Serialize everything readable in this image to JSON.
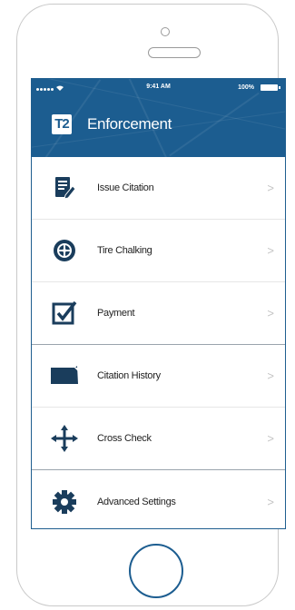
{
  "status_bar": {
    "time": "9:41 AM",
    "battery_percent": "100%"
  },
  "header": {
    "logo_text": "T2",
    "title": "Enforcement",
    "background_color": "#1c5d90"
  },
  "menu": {
    "items": [
      {
        "label": "Issue Citation",
        "icon": "clipboard-edit-icon"
      },
      {
        "label": "Tire Chalking",
        "icon": "tire-icon"
      },
      {
        "label": "Payment",
        "icon": "checkbox-icon"
      },
      {
        "label": "Citation History",
        "icon": "folder-icon"
      },
      {
        "label": "Cross Check",
        "icon": "crosshair-arrows-icon"
      },
      {
        "label": "Advanced Settings",
        "icon": "gear-icon"
      }
    ],
    "chevron": ">"
  }
}
